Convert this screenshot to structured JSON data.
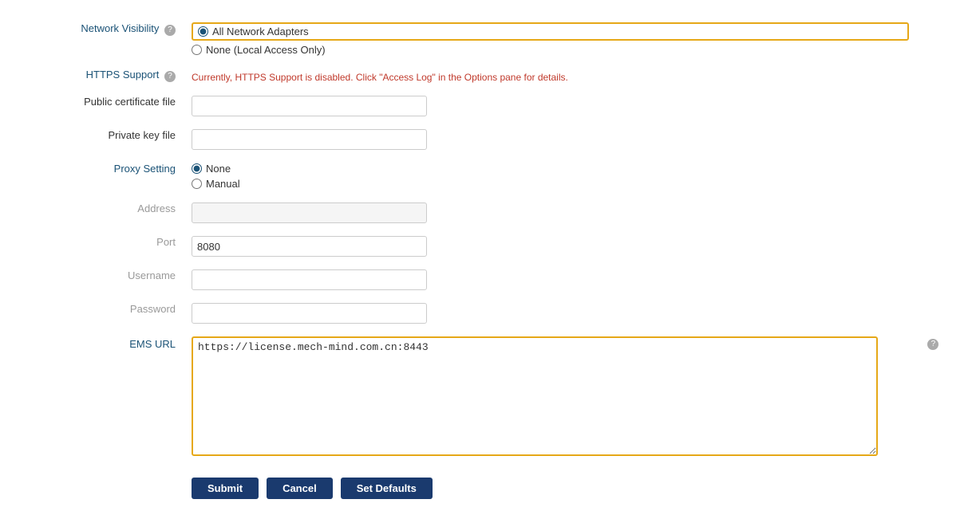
{
  "labels": {
    "network_visibility": "Network Visibility",
    "https_support": "HTTPS Support",
    "public_cert_file": "Public certificate file",
    "private_key_file": "Private key file",
    "proxy_setting": "Proxy Setting",
    "address": "Address",
    "port": "Port",
    "username": "Username",
    "password": "Password",
    "ems_url": "EMS URL"
  },
  "network_visibility": {
    "option_all": "All Network Adapters",
    "option_none": "None (Local Access Only)"
  },
  "https": {
    "message": "Currently, HTTPS Support is disabled. Click \"Access Log\" in the Options pane for details."
  },
  "proxy": {
    "option_none": "None",
    "option_manual": "Manual"
  },
  "fields": {
    "public_cert_value": "",
    "private_key_value": "",
    "address_value": "",
    "port_value": "8080",
    "username_value": "",
    "password_value": "",
    "ems_url_value": "https://license.mech-mind.com.cn:8443"
  },
  "buttons": {
    "submit": "Submit",
    "cancel": "Cancel",
    "set_defaults": "Set Defaults"
  },
  "icons": {
    "help": "?"
  }
}
